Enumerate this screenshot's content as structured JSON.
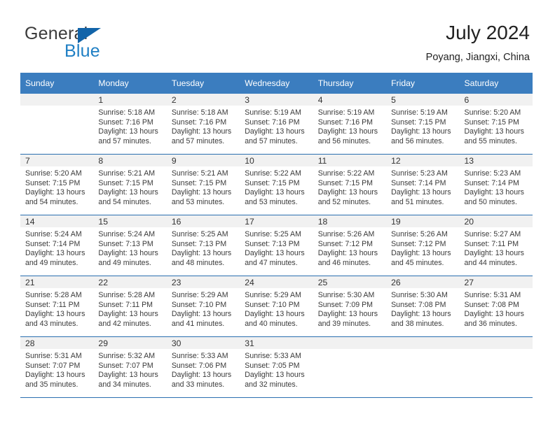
{
  "brand": {
    "name_top": "General",
    "name_bottom": "Blue",
    "accent_color": "#1f7fc4",
    "triangle_color": "#1264a9"
  },
  "header": {
    "title": "July 2024",
    "location": "Poyang, Jiangxi, China"
  },
  "theme": {
    "header_row_bg": "#3b7dbf",
    "row_divider": "#2a6fb0",
    "daynum_band_bg": "#f1f1f1",
    "text_color": "#3a3a3a"
  },
  "weekday_headers": [
    "Sunday",
    "Monday",
    "Tuesday",
    "Wednesday",
    "Thursday",
    "Friday",
    "Saturday"
  ],
  "weeks": [
    [
      {
        "day": "",
        "sunrise": "",
        "sunset": "",
        "daylight_line1": "",
        "daylight_line2": ""
      },
      {
        "day": "1",
        "sunrise": "Sunrise: 5:18 AM",
        "sunset": "Sunset: 7:16 PM",
        "daylight_line1": "Daylight: 13 hours",
        "daylight_line2": "and 57 minutes."
      },
      {
        "day": "2",
        "sunrise": "Sunrise: 5:18 AM",
        "sunset": "Sunset: 7:16 PM",
        "daylight_line1": "Daylight: 13 hours",
        "daylight_line2": "and 57 minutes."
      },
      {
        "day": "3",
        "sunrise": "Sunrise: 5:19 AM",
        "sunset": "Sunset: 7:16 PM",
        "daylight_line1": "Daylight: 13 hours",
        "daylight_line2": "and 57 minutes."
      },
      {
        "day": "4",
        "sunrise": "Sunrise: 5:19 AM",
        "sunset": "Sunset: 7:16 PM",
        "daylight_line1": "Daylight: 13 hours",
        "daylight_line2": "and 56 minutes."
      },
      {
        "day": "5",
        "sunrise": "Sunrise: 5:19 AM",
        "sunset": "Sunset: 7:15 PM",
        "daylight_line1": "Daylight: 13 hours",
        "daylight_line2": "and 56 minutes."
      },
      {
        "day": "6",
        "sunrise": "Sunrise: 5:20 AM",
        "sunset": "Sunset: 7:15 PM",
        "daylight_line1": "Daylight: 13 hours",
        "daylight_line2": "and 55 minutes."
      }
    ],
    [
      {
        "day": "7",
        "sunrise": "Sunrise: 5:20 AM",
        "sunset": "Sunset: 7:15 PM",
        "daylight_line1": "Daylight: 13 hours",
        "daylight_line2": "and 54 minutes."
      },
      {
        "day": "8",
        "sunrise": "Sunrise: 5:21 AM",
        "sunset": "Sunset: 7:15 PM",
        "daylight_line1": "Daylight: 13 hours",
        "daylight_line2": "and 54 minutes."
      },
      {
        "day": "9",
        "sunrise": "Sunrise: 5:21 AM",
        "sunset": "Sunset: 7:15 PM",
        "daylight_line1": "Daylight: 13 hours",
        "daylight_line2": "and 53 minutes."
      },
      {
        "day": "10",
        "sunrise": "Sunrise: 5:22 AM",
        "sunset": "Sunset: 7:15 PM",
        "daylight_line1": "Daylight: 13 hours",
        "daylight_line2": "and 53 minutes."
      },
      {
        "day": "11",
        "sunrise": "Sunrise: 5:22 AM",
        "sunset": "Sunset: 7:15 PM",
        "daylight_line1": "Daylight: 13 hours",
        "daylight_line2": "and 52 minutes."
      },
      {
        "day": "12",
        "sunrise": "Sunrise: 5:23 AM",
        "sunset": "Sunset: 7:14 PM",
        "daylight_line1": "Daylight: 13 hours",
        "daylight_line2": "and 51 minutes."
      },
      {
        "day": "13",
        "sunrise": "Sunrise: 5:23 AM",
        "sunset": "Sunset: 7:14 PM",
        "daylight_line1": "Daylight: 13 hours",
        "daylight_line2": "and 50 minutes."
      }
    ],
    [
      {
        "day": "14",
        "sunrise": "Sunrise: 5:24 AM",
        "sunset": "Sunset: 7:14 PM",
        "daylight_line1": "Daylight: 13 hours",
        "daylight_line2": "and 49 minutes."
      },
      {
        "day": "15",
        "sunrise": "Sunrise: 5:24 AM",
        "sunset": "Sunset: 7:13 PM",
        "daylight_line1": "Daylight: 13 hours",
        "daylight_line2": "and 49 minutes."
      },
      {
        "day": "16",
        "sunrise": "Sunrise: 5:25 AM",
        "sunset": "Sunset: 7:13 PM",
        "daylight_line1": "Daylight: 13 hours",
        "daylight_line2": "and 48 minutes."
      },
      {
        "day": "17",
        "sunrise": "Sunrise: 5:25 AM",
        "sunset": "Sunset: 7:13 PM",
        "daylight_line1": "Daylight: 13 hours",
        "daylight_line2": "and 47 minutes."
      },
      {
        "day": "18",
        "sunrise": "Sunrise: 5:26 AM",
        "sunset": "Sunset: 7:12 PM",
        "daylight_line1": "Daylight: 13 hours",
        "daylight_line2": "and 46 minutes."
      },
      {
        "day": "19",
        "sunrise": "Sunrise: 5:26 AM",
        "sunset": "Sunset: 7:12 PM",
        "daylight_line1": "Daylight: 13 hours",
        "daylight_line2": "and 45 minutes."
      },
      {
        "day": "20",
        "sunrise": "Sunrise: 5:27 AM",
        "sunset": "Sunset: 7:11 PM",
        "daylight_line1": "Daylight: 13 hours",
        "daylight_line2": "and 44 minutes."
      }
    ],
    [
      {
        "day": "21",
        "sunrise": "Sunrise: 5:28 AM",
        "sunset": "Sunset: 7:11 PM",
        "daylight_line1": "Daylight: 13 hours",
        "daylight_line2": "and 43 minutes."
      },
      {
        "day": "22",
        "sunrise": "Sunrise: 5:28 AM",
        "sunset": "Sunset: 7:11 PM",
        "daylight_line1": "Daylight: 13 hours",
        "daylight_line2": "and 42 minutes."
      },
      {
        "day": "23",
        "sunrise": "Sunrise: 5:29 AM",
        "sunset": "Sunset: 7:10 PM",
        "daylight_line1": "Daylight: 13 hours",
        "daylight_line2": "and 41 minutes."
      },
      {
        "day": "24",
        "sunrise": "Sunrise: 5:29 AM",
        "sunset": "Sunset: 7:10 PM",
        "daylight_line1": "Daylight: 13 hours",
        "daylight_line2": "and 40 minutes."
      },
      {
        "day": "25",
        "sunrise": "Sunrise: 5:30 AM",
        "sunset": "Sunset: 7:09 PM",
        "daylight_line1": "Daylight: 13 hours",
        "daylight_line2": "and 39 minutes."
      },
      {
        "day": "26",
        "sunrise": "Sunrise: 5:30 AM",
        "sunset": "Sunset: 7:08 PM",
        "daylight_line1": "Daylight: 13 hours",
        "daylight_line2": "and 38 minutes."
      },
      {
        "day": "27",
        "sunrise": "Sunrise: 5:31 AM",
        "sunset": "Sunset: 7:08 PM",
        "daylight_line1": "Daylight: 13 hours",
        "daylight_line2": "and 36 minutes."
      }
    ],
    [
      {
        "day": "28",
        "sunrise": "Sunrise: 5:31 AM",
        "sunset": "Sunset: 7:07 PM",
        "daylight_line1": "Daylight: 13 hours",
        "daylight_line2": "and 35 minutes."
      },
      {
        "day": "29",
        "sunrise": "Sunrise: 5:32 AM",
        "sunset": "Sunset: 7:07 PM",
        "daylight_line1": "Daylight: 13 hours",
        "daylight_line2": "and 34 minutes."
      },
      {
        "day": "30",
        "sunrise": "Sunrise: 5:33 AM",
        "sunset": "Sunset: 7:06 PM",
        "daylight_line1": "Daylight: 13 hours",
        "daylight_line2": "and 33 minutes."
      },
      {
        "day": "31",
        "sunrise": "Sunrise: 5:33 AM",
        "sunset": "Sunset: 7:05 PM",
        "daylight_line1": "Daylight: 13 hours",
        "daylight_line2": "and 32 minutes."
      },
      {
        "day": "",
        "sunrise": "",
        "sunset": "",
        "daylight_line1": "",
        "daylight_line2": ""
      },
      {
        "day": "",
        "sunrise": "",
        "sunset": "",
        "daylight_line1": "",
        "daylight_line2": ""
      },
      {
        "day": "",
        "sunrise": "",
        "sunset": "",
        "daylight_line1": "",
        "daylight_line2": ""
      }
    ]
  ]
}
